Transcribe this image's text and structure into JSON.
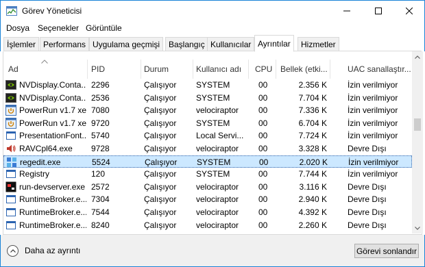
{
  "window": {
    "title": "Görev Yöneticisi",
    "minimize_label": "",
    "maximize_label": "",
    "close_label": ""
  },
  "menu": [
    {
      "label": "Dosya"
    },
    {
      "label": "Seçenekler"
    },
    {
      "label": "Görüntüle"
    }
  ],
  "tabs": [
    {
      "label": "İşlemler"
    },
    {
      "label": "Performans"
    },
    {
      "label": "Uygulama geçmişi"
    },
    {
      "label": "Başlangıç"
    },
    {
      "label": "Kullanıcılar"
    },
    {
      "label": "Ayrıntılar",
      "active": true
    },
    {
      "label": "Hizmetler"
    }
  ],
  "columns": [
    {
      "label": "Ad"
    },
    {
      "label": "PID"
    },
    {
      "label": "Durum"
    },
    {
      "label": "Kullanıcı adı"
    },
    {
      "label": "CPU"
    },
    {
      "label": "Bellek (etki..."
    },
    {
      "label": "UAC sanallaştır..."
    }
  ],
  "rows": [
    {
      "name": "NVDisplay.Conta...",
      "pid": "2296",
      "status": "Çalışıyor",
      "user": "SYSTEM",
      "cpu": "00",
      "mem": "2.356 K",
      "uac": "İzin verilmiyor",
      "icon": "nvidia-icon"
    },
    {
      "name": "NVDisplay.Conta...",
      "pid": "2536",
      "status": "Çalışıyor",
      "user": "SYSTEM",
      "cpu": "00",
      "mem": "7.704 K",
      "uac": "İzin verilmiyor",
      "icon": "nvidia-icon"
    },
    {
      "name": "PowerRun v1.7 xe",
      "pid": "7080",
      "status": "Çalışıyor",
      "user": "velociraptor",
      "cpu": "00",
      "mem": "7.336 K",
      "uac": "İzin verilmiyor",
      "icon": "powerrun-icon"
    },
    {
      "name": "PowerRun v1.7 xe",
      "pid": "9720",
      "status": "Çalışıyor",
      "user": "SYSTEM",
      "cpu": "00",
      "mem": "6.704 K",
      "uac": "İzin verilmiyor",
      "icon": "powerrun-icon"
    },
    {
      "name": "PresentationFont...",
      "pid": "5740",
      "status": "Çalışıyor",
      "user": "Local Servi...",
      "cpu": "00",
      "mem": "7.724 K",
      "uac": "İzin verilmiyor",
      "icon": "app-window-icon"
    },
    {
      "name": "RAVCpl64.exe",
      "pid": "9728",
      "status": "Çalışıyor",
      "user": "velociraptor",
      "cpu": "00",
      "mem": "3.328 K",
      "uac": "Devre Dışı",
      "icon": "speaker-icon"
    },
    {
      "name": "regedit.exe",
      "pid": "5524",
      "status": "Çalışıyor",
      "user": "SYSTEM",
      "cpu": "00",
      "mem": "2.020 K",
      "uac": "İzin verilmiyor",
      "icon": "regedit-icon",
      "selected": true
    },
    {
      "name": "Registry",
      "pid": "120",
      "status": "Çalışıyor",
      "user": "SYSTEM",
      "cpu": "00",
      "mem": "7.744 K",
      "uac": "İzin verilmiyor",
      "icon": "app-window-icon"
    },
    {
      "name": "run-devserver.exe",
      "pid": "2572",
      "status": "Çalışıyor",
      "user": "velociraptor",
      "cpu": "00",
      "mem": "3.116 K",
      "uac": "Devre Dışı",
      "icon": "devserver-icon"
    },
    {
      "name": "RuntimeBroker.e...",
      "pid": "7304",
      "status": "Çalışıyor",
      "user": "velociraptor",
      "cpu": "00",
      "mem": "2.940 K",
      "uac": "Devre Dışı",
      "icon": "app-window-icon"
    },
    {
      "name": "RuntimeBroker.e...",
      "pid": "7544",
      "status": "Çalışıyor",
      "user": "velociraptor",
      "cpu": "00",
      "mem": "4.392 K",
      "uac": "Devre Dışı",
      "icon": "app-window-icon"
    },
    {
      "name": "RuntimeBroker.e...",
      "pid": "8240",
      "status": "Çalışıyor",
      "user": "velociraptor",
      "cpu": "00",
      "mem": "2.260 K",
      "uac": "Devre Dışı",
      "icon": "app-window-icon"
    }
  ],
  "footer": {
    "fewer_details_label": "Daha az ayrıntı",
    "end_task_label": "Görevi sonlandır"
  },
  "colors": {
    "accent": "#1883d7",
    "selected_row": "#cce8ff"
  }
}
